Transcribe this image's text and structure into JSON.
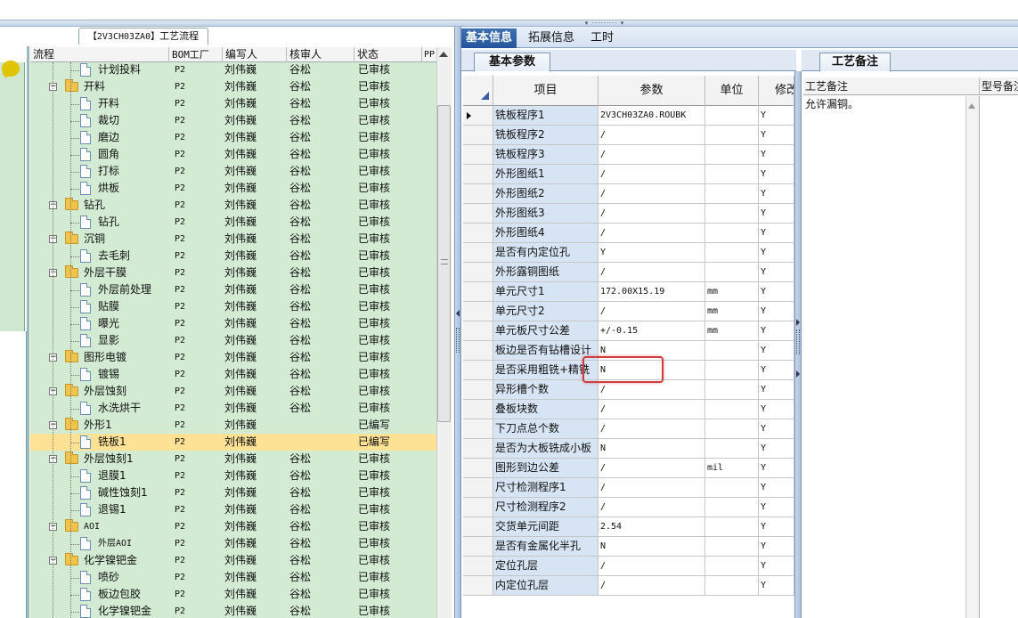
{
  "left_panel": {
    "tab_code": "【2V3CH03ZA0】",
    "tab_label": "工艺流程",
    "columns": [
      "流程",
      "BOM工厂",
      "编写人",
      "核审人",
      "状态",
      "PP"
    ],
    "rows": [
      {
        "level": 2,
        "type": "doc",
        "name": "计划投料",
        "plant": "P2",
        "writer": "刘伟巍",
        "reviewer": "谷松",
        "status": "已审核"
      },
      {
        "level": 1,
        "type": "folder",
        "name": "开料",
        "plant": "P2",
        "writer": "刘伟巍",
        "reviewer": "谷松",
        "status": "已审核"
      },
      {
        "level": 2,
        "type": "doc",
        "name": "开料",
        "plant": "P2",
        "writer": "刘伟巍",
        "reviewer": "谷松",
        "status": "已审核"
      },
      {
        "level": 2,
        "type": "doc",
        "name": "裁切",
        "plant": "P2",
        "writer": "刘伟巍",
        "reviewer": "谷松",
        "status": "已审核"
      },
      {
        "level": 2,
        "type": "doc",
        "name": "磨边",
        "plant": "P2",
        "writer": "刘伟巍",
        "reviewer": "谷松",
        "status": "已审核"
      },
      {
        "level": 2,
        "type": "doc",
        "name": "圆角",
        "plant": "P2",
        "writer": "刘伟巍",
        "reviewer": "谷松",
        "status": "已审核"
      },
      {
        "level": 2,
        "type": "doc",
        "name": "打标",
        "plant": "P2",
        "writer": "刘伟巍",
        "reviewer": "谷松",
        "status": "已审核"
      },
      {
        "level": 2,
        "type": "doc",
        "name": "烘板",
        "plant": "P2",
        "writer": "刘伟巍",
        "reviewer": "谷松",
        "status": "已审核"
      },
      {
        "level": 1,
        "type": "folder",
        "name": "钻孔",
        "plant": "P2",
        "writer": "刘伟巍",
        "reviewer": "谷松",
        "status": "已审核"
      },
      {
        "level": 2,
        "type": "doc",
        "name": "钻孔",
        "plant": "P2",
        "writer": "刘伟巍",
        "reviewer": "谷松",
        "status": "已审核"
      },
      {
        "level": 1,
        "type": "folder",
        "name": "沉铜",
        "plant": "P2",
        "writer": "刘伟巍",
        "reviewer": "谷松",
        "status": "已审核"
      },
      {
        "level": 2,
        "type": "doc",
        "name": "去毛刺",
        "plant": "P2",
        "writer": "刘伟巍",
        "reviewer": "谷松",
        "status": "已审核"
      },
      {
        "level": 1,
        "type": "folder",
        "name": "外层干膜",
        "plant": "P2",
        "writer": "刘伟巍",
        "reviewer": "谷松",
        "status": "已审核"
      },
      {
        "level": 2,
        "type": "doc",
        "name": "外层前处理",
        "plant": "P2",
        "writer": "刘伟巍",
        "reviewer": "谷松",
        "status": "已审核"
      },
      {
        "level": 2,
        "type": "doc",
        "name": "贴膜",
        "plant": "P2",
        "writer": "刘伟巍",
        "reviewer": "谷松",
        "status": "已审核"
      },
      {
        "level": 2,
        "type": "doc",
        "name": "曝光",
        "plant": "P2",
        "writer": "刘伟巍",
        "reviewer": "谷松",
        "status": "已审核"
      },
      {
        "level": 2,
        "type": "doc",
        "name": "显影",
        "plant": "P2",
        "writer": "刘伟巍",
        "reviewer": "谷松",
        "status": "已审核"
      },
      {
        "level": 1,
        "type": "folder",
        "name": "图形电镀",
        "plant": "P2",
        "writer": "刘伟巍",
        "reviewer": "谷松",
        "status": "已审核"
      },
      {
        "level": 2,
        "type": "doc",
        "name": "镀锡",
        "plant": "P2",
        "writer": "刘伟巍",
        "reviewer": "谷松",
        "status": "已审核"
      },
      {
        "level": 1,
        "type": "folder",
        "name": "外层蚀刻",
        "plant": "P2",
        "writer": "刘伟巍",
        "reviewer": "谷松",
        "status": "已审核"
      },
      {
        "level": 2,
        "type": "doc",
        "name": "水洗烘干",
        "plant": "P2",
        "writer": "刘伟巍",
        "reviewer": "谷松",
        "status": "已审核"
      },
      {
        "level": 1,
        "type": "folder",
        "name": "外形1",
        "plant": "P2",
        "writer": "刘伟巍",
        "reviewer": "",
        "status": "已编写"
      },
      {
        "level": 2,
        "type": "doc",
        "name": "铣板1",
        "plant": "P2",
        "writer": "刘伟巍",
        "reviewer": "",
        "status": "已编写",
        "selected": true
      },
      {
        "level": 1,
        "type": "folder",
        "name": "外层蚀刻1",
        "plant": "P2",
        "writer": "刘伟巍",
        "reviewer": "谷松",
        "status": "已审核"
      },
      {
        "level": 2,
        "type": "doc",
        "name": "退膜1",
        "plant": "P2",
        "writer": "刘伟巍",
        "reviewer": "谷松",
        "status": "已审核"
      },
      {
        "level": 2,
        "type": "doc",
        "name": "碱性蚀刻1",
        "plant": "P2",
        "writer": "刘伟巍",
        "reviewer": "谷松",
        "status": "已审核"
      },
      {
        "level": 2,
        "type": "doc",
        "name": "退锡1",
        "plant": "P2",
        "writer": "刘伟巍",
        "reviewer": "谷松",
        "status": "已审核"
      },
      {
        "level": 1,
        "type": "folder",
        "name": "AOI",
        "plant": "P2",
        "writer": "刘伟巍",
        "reviewer": "谷松",
        "status": "已审核"
      },
      {
        "level": 2,
        "type": "doc",
        "name": "外层AOI",
        "plant": "P2",
        "writer": "刘伟巍",
        "reviewer": "谷松",
        "status": "已审核"
      },
      {
        "level": 1,
        "type": "folder",
        "name": "化学镍钯金",
        "plant": "P2",
        "writer": "刘伟巍",
        "reviewer": "谷松",
        "status": "已审核"
      },
      {
        "level": 2,
        "type": "doc",
        "name": "喷砂",
        "plant": "P2",
        "writer": "刘伟巍",
        "reviewer": "谷松",
        "status": "已审核"
      },
      {
        "level": 2,
        "type": "doc",
        "name": "板边包胶",
        "plant": "P2",
        "writer": "刘伟巍",
        "reviewer": "谷松",
        "status": "已审核"
      },
      {
        "level": 2,
        "type": "doc",
        "name": "化学镍钯金",
        "plant": "P2",
        "writer": "刘伟巍",
        "reviewer": "谷松",
        "status": "已审核"
      }
    ]
  },
  "top_tabs": [
    "基本信息",
    "拓展信息",
    "工时"
  ],
  "params_panel": {
    "subtab": "基本参数",
    "columns": [
      "项目",
      "参数",
      "单位",
      "修改"
    ],
    "rows": [
      {
        "item": "铣板程序1",
        "param": "2V3CH03ZA0.ROUBK",
        "unit": "",
        "mod": "Y",
        "current": true
      },
      {
        "item": "铣板程序2",
        "param": "/",
        "unit": "",
        "mod": "Y"
      },
      {
        "item": "铣板程序3",
        "param": "/",
        "unit": "",
        "mod": "Y"
      },
      {
        "item": "外形图纸1",
        "param": "/",
        "unit": "",
        "mod": "Y"
      },
      {
        "item": "外形图纸2",
        "param": "/",
        "unit": "",
        "mod": "Y"
      },
      {
        "item": "外形图纸3",
        "param": "/",
        "unit": "",
        "mod": "Y"
      },
      {
        "item": "外形图纸4",
        "param": "/",
        "unit": "",
        "mod": "Y"
      },
      {
        "item": "是否有内定位孔",
        "param": "Y",
        "unit": "",
        "mod": "Y"
      },
      {
        "item": "外形露铜图纸",
        "param": "/",
        "unit": "",
        "mod": "Y"
      },
      {
        "item": "单元尺寸1",
        "param": "172.00X15.19",
        "unit": "mm",
        "mod": "Y"
      },
      {
        "item": "单元尺寸2",
        "param": "/",
        "unit": "mm",
        "mod": "Y"
      },
      {
        "item": "单元板尺寸公差",
        "param": "+/-0.15",
        "unit": "mm",
        "mod": "Y"
      },
      {
        "item": "板边是否有钻槽设计",
        "param": "N",
        "unit": "",
        "mod": "Y"
      },
      {
        "item": "是否采用粗铣+精铣",
        "param": "N",
        "unit": "",
        "mod": "Y"
      },
      {
        "item": "异形槽个数",
        "param": "/",
        "unit": "",
        "mod": "Y"
      },
      {
        "item": "叠板块数",
        "param": "/",
        "unit": "",
        "mod": "Y"
      },
      {
        "item": "下刀点总个数",
        "param": "/",
        "unit": "",
        "mod": "Y"
      },
      {
        "item": "是否为大板铣成小板",
        "param": "N",
        "unit": "",
        "mod": "Y"
      },
      {
        "item": "图形到边公差",
        "param": "/",
        "unit": "mil",
        "mod": "Y"
      },
      {
        "item": "尺寸检测程序1",
        "param": "/",
        "unit": "",
        "mod": "Y"
      },
      {
        "item": "尺寸检测程序2",
        "param": "/",
        "unit": "",
        "mod": "Y"
      },
      {
        "item": "交货单元间距",
        "param": "2.54",
        "unit": "",
        "mod": "Y"
      },
      {
        "item": "是否有金属化半孔",
        "param": "N",
        "unit": "",
        "mod": "Y"
      },
      {
        "item": "定位孔层",
        "param": "/",
        "unit": "",
        "mod": "Y"
      },
      {
        "item": "内定位孔层",
        "param": "/",
        "unit": "",
        "mod": "Y"
      }
    ]
  },
  "notes_panel": {
    "tab": "工艺备注",
    "columns": [
      "工艺备注",
      "型号备注"
    ],
    "note_text": "允许漏铜。"
  }
}
